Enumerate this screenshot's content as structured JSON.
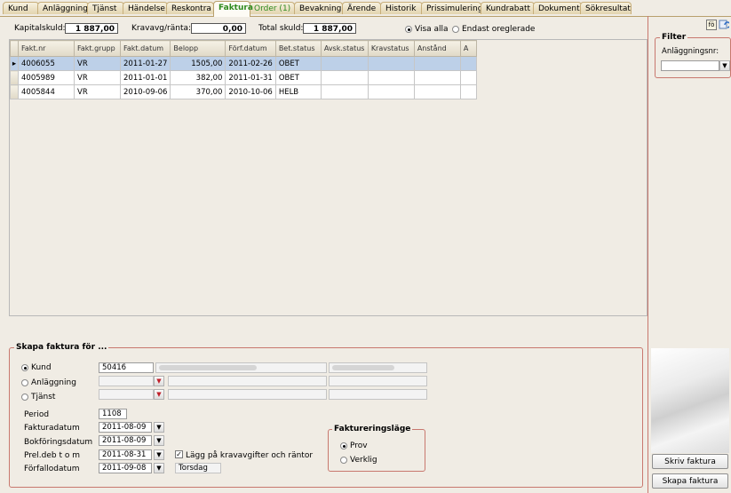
{
  "tabs": [
    {
      "label": "Kund"
    },
    {
      "label": "Anläggning"
    },
    {
      "label": "Tjänst"
    },
    {
      "label": "Händelse"
    },
    {
      "label": "Reskontra"
    },
    {
      "label": "Faktura",
      "active": true
    },
    {
      "label": "Order (1)"
    },
    {
      "label": "Bevakning"
    },
    {
      "label": "Ärende"
    },
    {
      "label": "Historik"
    },
    {
      "label": "Prissimulering"
    },
    {
      "label": "Kundrabatt"
    },
    {
      "label": "Dokument"
    },
    {
      "label": "Sökresultat"
    }
  ],
  "summary": {
    "kapitalskuld_label": "Kapitalskuld:",
    "kapitalskuld_value": "1 887,00",
    "kravavg_label": "Kravavg/ränta:",
    "kravavg_value": "0,00",
    "total_label": "Total skuld:",
    "total_value": "1 887,00",
    "visa_alla": "Visa alla",
    "endast_oreglerade": "Endast oreglerade"
  },
  "grid": {
    "columns": [
      "Fakt.nr",
      "Fakt.grupp",
      "Fakt.datum",
      "Belopp",
      "Förf.datum",
      "Bet.status",
      "Avsk.status",
      "Kravstatus",
      "Anstånd",
      "A"
    ],
    "rows": [
      [
        "4006055",
        "VR",
        "2011-01-27",
        "1505,00",
        "2011-02-26",
        "OBET",
        "",
        "",
        "",
        ""
      ],
      [
        "4005989",
        "VR",
        "2011-01-01",
        "382,00",
        "2011-01-31",
        "OBET",
        "",
        "",
        "",
        ""
      ],
      [
        "4005844",
        "VR",
        "2010-09-06",
        "370,00",
        "2010-10-06",
        "HELB",
        "",
        "",
        "",
        ""
      ]
    ],
    "selected_row": 0
  },
  "filter": {
    "title": "Filter",
    "anlaggningsnr_label": "Anläggningsnr:",
    "anlaggningsnr_value": ""
  },
  "create": {
    "title": "Skapa faktura för ...",
    "kund_label": "Kund",
    "kund_value": "50416",
    "anlaggning_label": "Anläggning",
    "tjanst_label": "Tjänst",
    "period_label": "Period",
    "period_value": "1108",
    "fakturadatum_label": "Fakturadatum",
    "fakturadatum_value": "2011-08-09",
    "bokforingsdatum_label": "Bokföringsdatum",
    "bokforingsdatum_value": "2011-08-09",
    "preldeb_label": "Prel.deb t o m",
    "preldeb_value": "2011-08-31",
    "forfallodatum_label": "Förfallodatum",
    "forfallodatum_value": "2011-09-08",
    "lagg_pa_label": "Lägg på kravavgifter och räntor",
    "weekday": "Torsdag",
    "mode_title": "Faktureringsläge",
    "mode_prov": "Prov",
    "mode_verklig": "Verklig"
  },
  "buttons": {
    "skriv": "Skriv faktura",
    "skapa": "Skapa faktura"
  }
}
